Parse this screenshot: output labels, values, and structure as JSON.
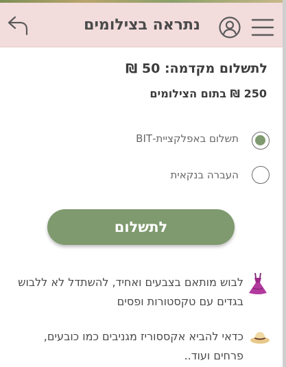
{
  "header": {
    "title": "נתראה בצילומים",
    "back_icon": "reply-arrow-icon",
    "user_icon": "user-circle-icon",
    "menu_icon": "hamburger-menu-icon",
    "background_color": "#f3dcdc"
  },
  "payment": {
    "advance_label": "לתשלום מקדמה: 50 ₪",
    "total_label": "250 ₪ בתום הצילומים"
  },
  "options": [
    {
      "label": "תשלום באפלקציית-BIT",
      "selected": true
    },
    {
      "label": "העברה בנקאית",
      "selected": false
    }
  ],
  "pay_button": {
    "label": "לתשלום",
    "color": "#7f9a6e"
  },
  "tips": [
    {
      "icon": "dress-icon",
      "text": "לבוש מותאם בצבעים ואחיד, להשתדל לא ללבוש בגדים עם טקסטורות ופסים"
    },
    {
      "icon": "sun-hat-icon",
      "text": "כדאי להביא אקססוריז מגניבים כמו כובעים, פרחים ועוד.."
    }
  ]
}
